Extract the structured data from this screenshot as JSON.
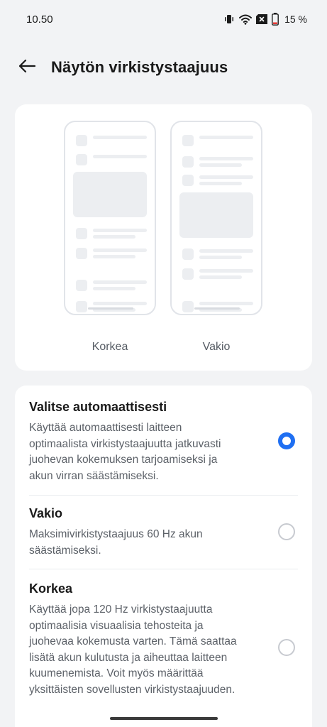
{
  "status_bar": {
    "time": "10.50",
    "battery_percent": "15 %",
    "icons": [
      "vibrate-icon",
      "wifi-icon",
      "no-sim-icon",
      "battery-icon"
    ]
  },
  "header": {
    "back_icon": "arrow-left-icon",
    "title": "Näytön virkistystaajuus"
  },
  "preview": {
    "left_label": "Korkea",
    "right_label": "Vakio"
  },
  "options": [
    {
      "title": "Valitse automaattisesti",
      "description": "Käyttää automaattisesti laitteen optimaalista virkistystaajuutta jatkuvasti juohevan kokemuksen tarjoamiseksi ja akun virran säästämiseksi.",
      "selected": true
    },
    {
      "title": "Vakio",
      "description": "Maksimivirkistystaajuus 60 Hz akun säästämiseksi.",
      "selected": false
    },
    {
      "title": "Korkea",
      "description": "Käyttää jopa 120 Hz virkistystaajuutta optimaalisia visuaalisia tehosteita ja juohevaa kokemusta varten. Tämä saattaa lisätä akun kulutusta ja aiheuttaa laitteen kuumenemista. Voit myös määrittää yksittäisten sovellusten virkistystaajuuden.",
      "selected": false
    }
  ],
  "colors": {
    "accent": "#1f6ff2",
    "background": "#f2f3f5",
    "card": "#ffffff"
  }
}
